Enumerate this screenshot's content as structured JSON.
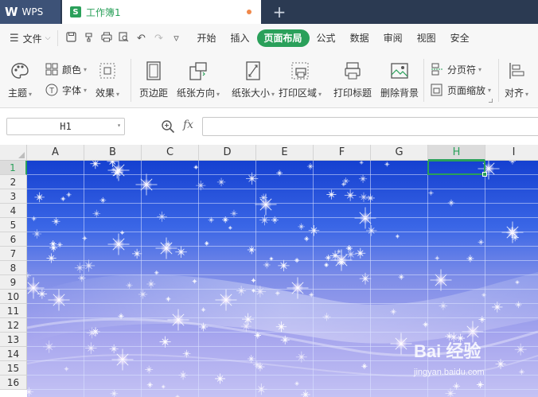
{
  "titlebar": {
    "app_label": "WPS",
    "doc_name": "工作簿1",
    "new_tab": "+"
  },
  "menubar": {
    "file_label": "文件",
    "tabs": [
      "开始",
      "插入",
      "页面布局",
      "公式",
      "数据",
      "审阅",
      "视图",
      "安全"
    ],
    "active_tab": "页面布局"
  },
  "ribbon": {
    "theme": "主题",
    "colors": "颜色",
    "fonts": "字体",
    "effects": "效果",
    "margins": "页边距",
    "orientation": "纸张方向",
    "size": "纸张大小",
    "print_area": "打印区域",
    "print_titles": "打印标题",
    "delete_background": "删除背景",
    "page_break": "分页符",
    "page_zoom": "页面缩放",
    "align": "对齐"
  },
  "formula_bar": {
    "name_box": "H1",
    "fx": "fx",
    "formula": ""
  },
  "grid": {
    "columns": [
      "A",
      "B",
      "C",
      "D",
      "E",
      "F",
      "G",
      "H",
      "I"
    ],
    "rows": [
      "1",
      "2",
      "3",
      "4",
      "5",
      "6",
      "7",
      "8",
      "9",
      "10",
      "11",
      "12",
      "13",
      "14",
      "15",
      "16"
    ],
    "selected_column": "H",
    "selected_row": "1"
  },
  "watermark": {
    "main": "Bai 经验",
    "sub": "jingyan.baidu.com"
  },
  "colors": {
    "accent_green": "#2aa05a",
    "titlebar": "#2b3a52",
    "background_top": "#1a4fd8",
    "background_bottom": "#b9b8f0"
  }
}
